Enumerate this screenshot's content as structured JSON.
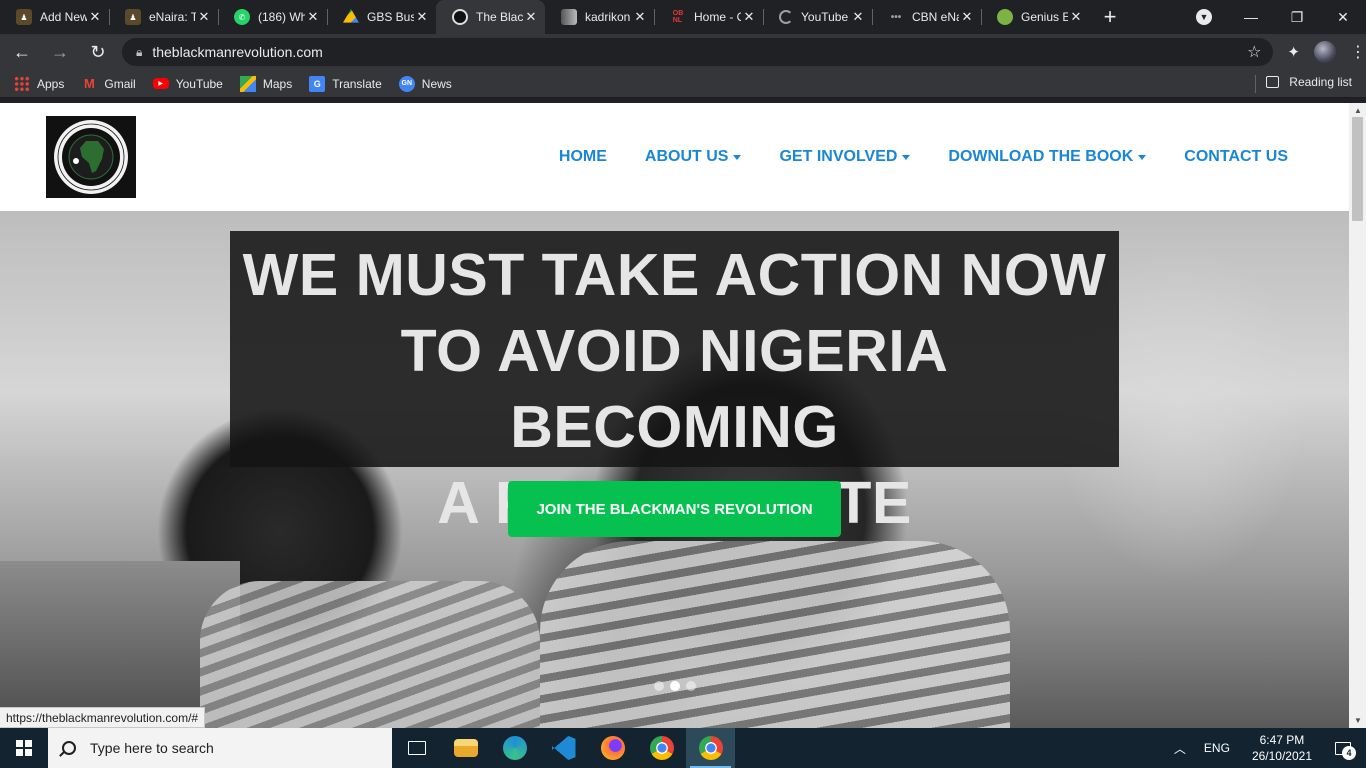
{
  "tabs": [
    {
      "title": "Add New",
      "favicon": "person-icon",
      "color": "#5a4a2a"
    },
    {
      "title": "eNaira: T",
      "favicon": "person-icon",
      "color": "#5a4a2a"
    },
    {
      "title": "(186) Wh",
      "favicon": "whatsapp-icon",
      "color": "#25d366"
    },
    {
      "title": "GBS Busi",
      "favicon": "drive-icon",
      "color": "#fbbc04"
    },
    {
      "title": "The Black",
      "favicon": "site-logo-icon",
      "color": "#111111",
      "active": true
    },
    {
      "title": "kadrikon",
      "favicon": "photo-icon",
      "color": "#8a8a8a"
    },
    {
      "title": "Home - O",
      "favicon": "obnl-icon",
      "color": "#c62828"
    },
    {
      "title": "YouTube",
      "favicon": "loading-spinner-icon",
      "color": "#9aa0a6"
    },
    {
      "title": "CBN eNa",
      "favicon": "dots-icon",
      "color": "#9aa0a6"
    },
    {
      "title": "Genius E",
      "favicon": "genius-icon",
      "color": "#7cb342"
    }
  ],
  "address_bar": {
    "url": "theblackmanrevolution.com"
  },
  "bookmarks": [
    {
      "label": "Apps",
      "icon": "apps-grid-icon"
    },
    {
      "label": "Gmail",
      "icon": "gmail-icon"
    },
    {
      "label": "YouTube",
      "icon": "youtube-icon"
    },
    {
      "label": "Maps",
      "icon": "maps-icon"
    },
    {
      "label": "Translate",
      "icon": "translate-icon"
    },
    {
      "label": "News",
      "icon": "news-icon"
    }
  ],
  "reading_list": "Reading list",
  "site": {
    "logo_text_top": "THE BLACKMAN'S REVOLUTION",
    "logo_text_bottom": "TBR",
    "nav": [
      {
        "label": "HOME",
        "dropdown": false
      },
      {
        "label": "ABOUT US",
        "dropdown": true
      },
      {
        "label": "GET INVOLVED",
        "dropdown": true
      },
      {
        "label": "DOWNLOAD THE BOOK",
        "dropdown": true
      },
      {
        "label": "CONTACT US",
        "dropdown": false
      }
    ],
    "hero": {
      "headline_lines": [
        "WE MUST TAKE ACTION NOW",
        "TO AVOID NIGERIA BECOMING",
        "A FAILED STATE"
      ],
      "cta": "JOIN THE BLACKMAN'S REVOLUTION",
      "cta_color": "#06c04f",
      "slides": 3,
      "active_slide": 2
    }
  },
  "status_url": "https://theblackmanrevolution.com/#",
  "taskbar": {
    "search_placeholder": "Type here to search",
    "apps": [
      {
        "name": "task-view-icon",
        "color": "#13232f"
      },
      {
        "name": "file-explorer-icon",
        "color": "#f0c24a"
      },
      {
        "name": "edge-icon",
        "color": "#1f8fd8"
      },
      {
        "name": "vscode-icon",
        "color": "#1e8ad6"
      },
      {
        "name": "firefox-icon",
        "color": "#ff7139"
      },
      {
        "name": "chrome-icon",
        "color": "#4caf50"
      },
      {
        "name": "chrome-profile-icon",
        "color": "#4caf50",
        "active": true
      }
    ],
    "language": "ENG",
    "time": "6:47 PM",
    "date": "26/10/2021",
    "notifications": "4"
  }
}
